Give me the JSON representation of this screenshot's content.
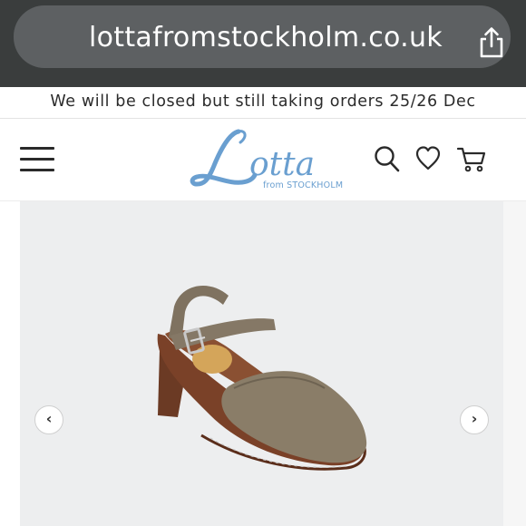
{
  "browser": {
    "url": "lottafromstockholm.co.uk",
    "share_icon": "share-icon"
  },
  "announcement": {
    "text": "We will be closed but still taking orders 25/26 Dec"
  },
  "header": {
    "logo_text": "Lotta",
    "logo_subtext": "from STOCKHOLM",
    "menu_icon": "hamburger-menu-icon",
    "search_icon": "search-icon",
    "wishlist_icon": "heart-icon",
    "cart_icon": "cart-icon"
  },
  "colors": {
    "browser_bg": "#3a3d3d",
    "url_pill": "#5d6062",
    "logo_blue": "#6a9fd0",
    "gallery_bg": "#edeeef"
  },
  "gallery": {
    "image": "product-clog-sandal-image",
    "prev_label": "‹",
    "next_label": "›"
  }
}
